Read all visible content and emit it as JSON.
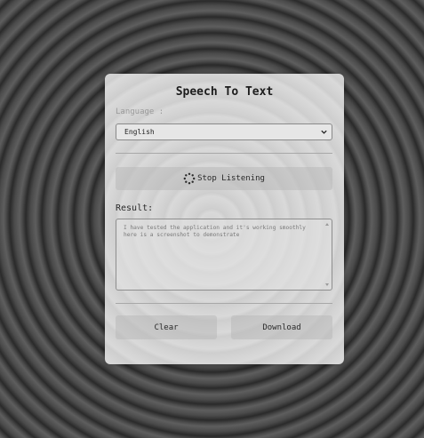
{
  "app": {
    "title": "Speech To Text"
  },
  "language": {
    "label": "Language :",
    "selected": "English"
  },
  "listen_button": {
    "label": "Stop Listening",
    "icon": "spinner-icon"
  },
  "result": {
    "label": "Result:",
    "text": "I have tested the application and it's working smoothly here is a screenshot to demonstrate"
  },
  "actions": {
    "clear_label": "Clear",
    "download_label": "Download"
  },
  "colors": {
    "card_background": "#d9d9d9",
    "button_background": "#c4c4c4",
    "text": "#2a2a2a"
  }
}
